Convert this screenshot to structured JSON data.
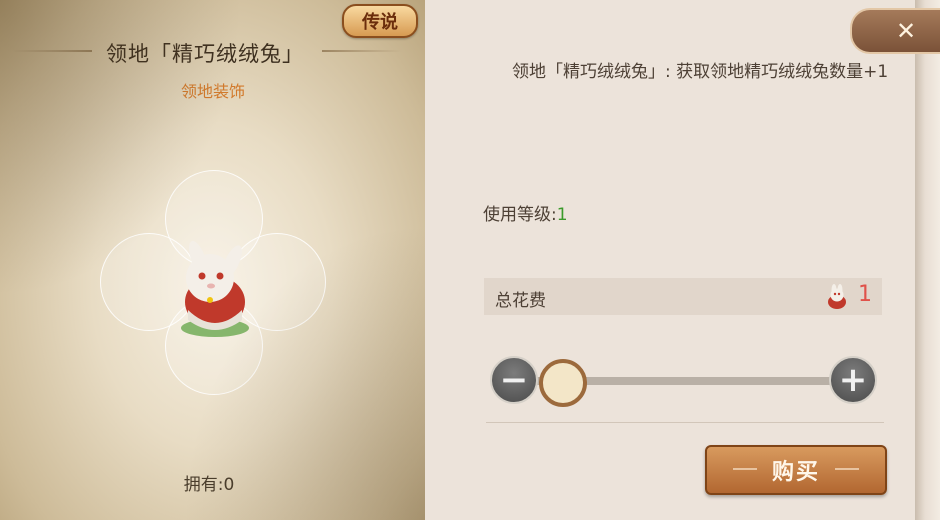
{
  "item": {
    "rarity": "传说",
    "title": "领地「精巧绒绒兔」",
    "category": "领地装饰",
    "owned": "拥有:0",
    "description": "领地「精巧绒绒兔」: 获取领地精巧绒绒兔数量+1"
  },
  "purchase": {
    "level_label": "使用等级:",
    "level_value": "1",
    "cost_label": "总花费",
    "cost_value": "1",
    "minus": "−",
    "plus": "+",
    "buy_label": "购买",
    "quantity_fraction": 0
  },
  "colors": {
    "category": "#d27a2c",
    "level_value": "#3a9a2a",
    "cost_value": "#e0524a",
    "buy_button": "#c07a3f"
  },
  "icons": {
    "close": "close-icon",
    "item": "white-rabbit-icon",
    "currency": "rabbit-token-icon"
  }
}
